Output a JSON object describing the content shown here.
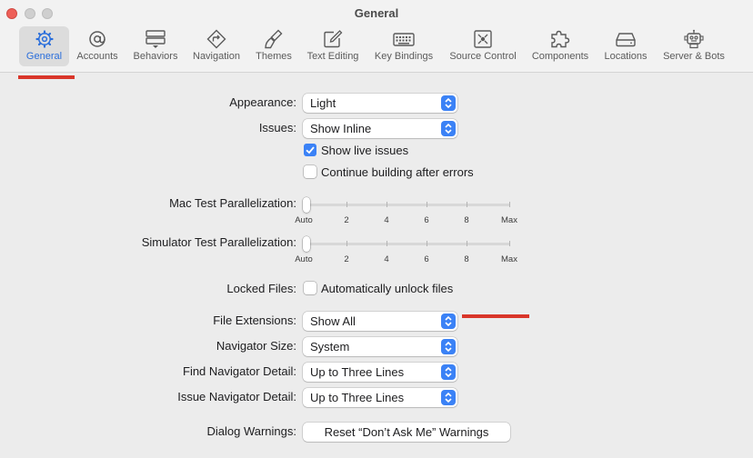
{
  "window": {
    "title": "General"
  },
  "toolbar": {
    "tabs": [
      {
        "label": "General",
        "icon": "gear-icon",
        "active": true
      },
      {
        "label": "Accounts",
        "icon": "at-icon"
      },
      {
        "label": "Behaviors",
        "icon": "behaviors-icon"
      },
      {
        "label": "Navigation",
        "icon": "navigation-icon"
      },
      {
        "label": "Themes",
        "icon": "brush-icon"
      },
      {
        "label": "Text Editing",
        "icon": "pencil-square-icon"
      },
      {
        "label": "Key Bindings",
        "icon": "keyboard-icon"
      },
      {
        "label": "Source Control",
        "icon": "source-control-icon"
      },
      {
        "label": "Components",
        "icon": "puzzle-icon"
      },
      {
        "label": "Locations",
        "icon": "drive-icon"
      },
      {
        "label": "Server & Bots",
        "icon": "robot-icon"
      }
    ]
  },
  "settings": {
    "appearance": {
      "label": "Appearance:",
      "value": "Light"
    },
    "issues": {
      "label": "Issues:",
      "value": "Show Inline"
    },
    "show_live_issues": {
      "label": "Show live issues",
      "checked": true
    },
    "continue_building": {
      "label": "Continue building after errors",
      "checked": false
    },
    "mac_test": {
      "label": "Mac Test Parallelization:"
    },
    "sim_test": {
      "label": "Simulator Test Parallelization:"
    },
    "slider_ticks": [
      "Auto",
      "2",
      "4",
      "6",
      "8",
      "Max"
    ],
    "mac_test_value": "Auto",
    "sim_test_value": "Auto",
    "locked_files": {
      "label": "Locked Files:",
      "checkbox_label": "Automatically unlock files",
      "checked": false
    },
    "file_extensions": {
      "label": "File Extensions:",
      "value": "Show All"
    },
    "navigator_size": {
      "label": "Navigator Size:",
      "value": "System"
    },
    "find_navigator": {
      "label": "Find Navigator Detail:",
      "value": "Up to Three Lines"
    },
    "issue_navigator": {
      "label": "Issue Navigator Detail:",
      "value": "Up to Three Lines"
    },
    "dialog_warnings": {
      "label": "Dialog Warnings:",
      "button": "Reset “Don’t Ask Me” Warnings"
    }
  },
  "colors": {
    "accent": "#3b82f6",
    "annotation_red": "#d9362a"
  }
}
